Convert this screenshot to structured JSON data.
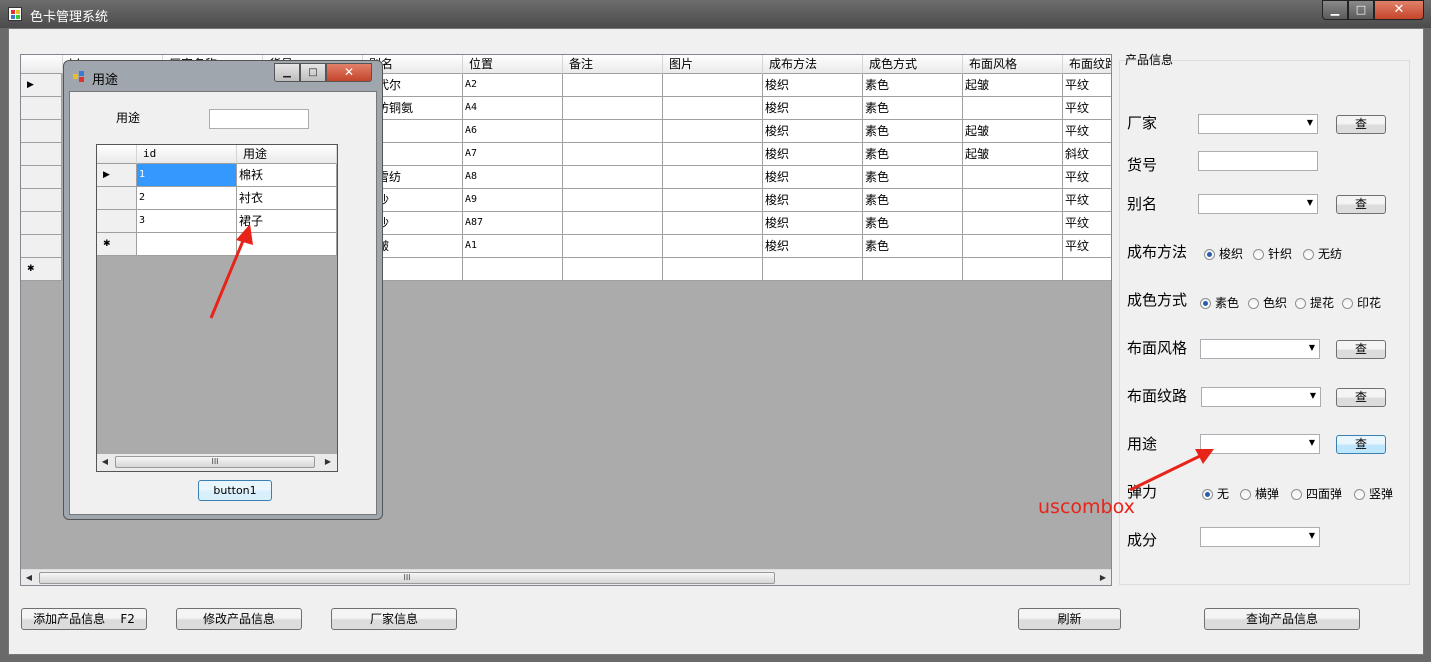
{
  "app": {
    "title": "色卡管理系统",
    "caption_min": "▁",
    "caption_max": "□",
    "caption_close": "✕"
  },
  "grid": {
    "headers": [
      "id",
      "厂家名称",
      "货号",
      "别名",
      "位置",
      "备注",
      "图片",
      "成布方法",
      "成色方式",
      "布面风格",
      "布面纹路"
    ],
    "rows": [
      [
        "",
        "",
        "",
        "蕾代尔",
        "A2",
        "",
        "",
        "梭织",
        "素色",
        "起皱",
        "平纹"
      ],
      [
        "",
        "",
        "",
        "元仿铜氨",
        "A4",
        "",
        "",
        "梭织",
        "素色",
        "",
        "平纹"
      ],
      [
        "",
        "",
        "",
        "",
        "A6",
        "",
        "",
        "梭织",
        "素色",
        "起皱",
        "平纹"
      ],
      [
        "",
        "",
        "",
        "",
        "A7",
        "",
        "",
        "梭织",
        "素色",
        "起皱",
        "斜纹"
      ],
      [
        "",
        "",
        "",
        "株雪纺",
        "A8",
        "",
        "",
        "梭织",
        "素色",
        "",
        "平纹"
      ],
      [
        "",
        "",
        "",
        "飞沙",
        "A9",
        "",
        "",
        "梭织",
        "素色",
        "",
        "平纹"
      ],
      [
        "",
        "",
        "",
        "飞沙",
        "A87",
        "",
        "",
        "梭织",
        "素色",
        "",
        "平纹"
      ],
      [
        "",
        "",
        "",
        "米皱",
        "A1",
        "",
        "",
        "梭织",
        "素色",
        "",
        "平纹"
      ]
    ],
    "current_row_marker": "▶",
    "new_row_marker": "✱",
    "scroll_left": "◀",
    "scroll_right": "▶",
    "scroll_grip": "III"
  },
  "panel": {
    "title": "产品信息",
    "labels": {
      "manufacturer": "厂家",
      "item_no": "货号",
      "alias": "别名",
      "weaving": "成布方法",
      "coloring": "成色方式",
      "surface_style": "布面风格",
      "surface_texture": "布面纹路",
      "usage": "用途",
      "elastic": "弹力",
      "composition": "成分"
    },
    "query_label": "查",
    "weaving_options": [
      "梭织",
      "针织",
      "无纺"
    ],
    "coloring_options": [
      "素色",
      "色织",
      "提花",
      "印花"
    ],
    "elastic_options": [
      "无",
      "横弹",
      "四面弹",
      "竖弹"
    ],
    "combo_arrow": "▼"
  },
  "buttons": {
    "add": "添加产品信息    F2",
    "edit": "修改产品信息",
    "manufacturer_info": "厂家信息",
    "refresh": "刷新",
    "query": "查询产品信息"
  },
  "dialog": {
    "title": "用途",
    "field_label": "用途",
    "field_value": "",
    "headers": [
      "id",
      "用途"
    ],
    "rows": [
      [
        "1",
        "棉袄"
      ],
      [
        "2",
        "衬衣"
      ],
      [
        "3",
        "裙子"
      ]
    ],
    "button": "button1",
    "caption_min": "▁",
    "caption_max": "□",
    "caption_close": "✕"
  },
  "annotation": {
    "text": "uscombox",
    "color": "#e8241a"
  },
  "colors": {
    "selected_cell": "#3399ff",
    "accent_red": "#e8241a"
  }
}
